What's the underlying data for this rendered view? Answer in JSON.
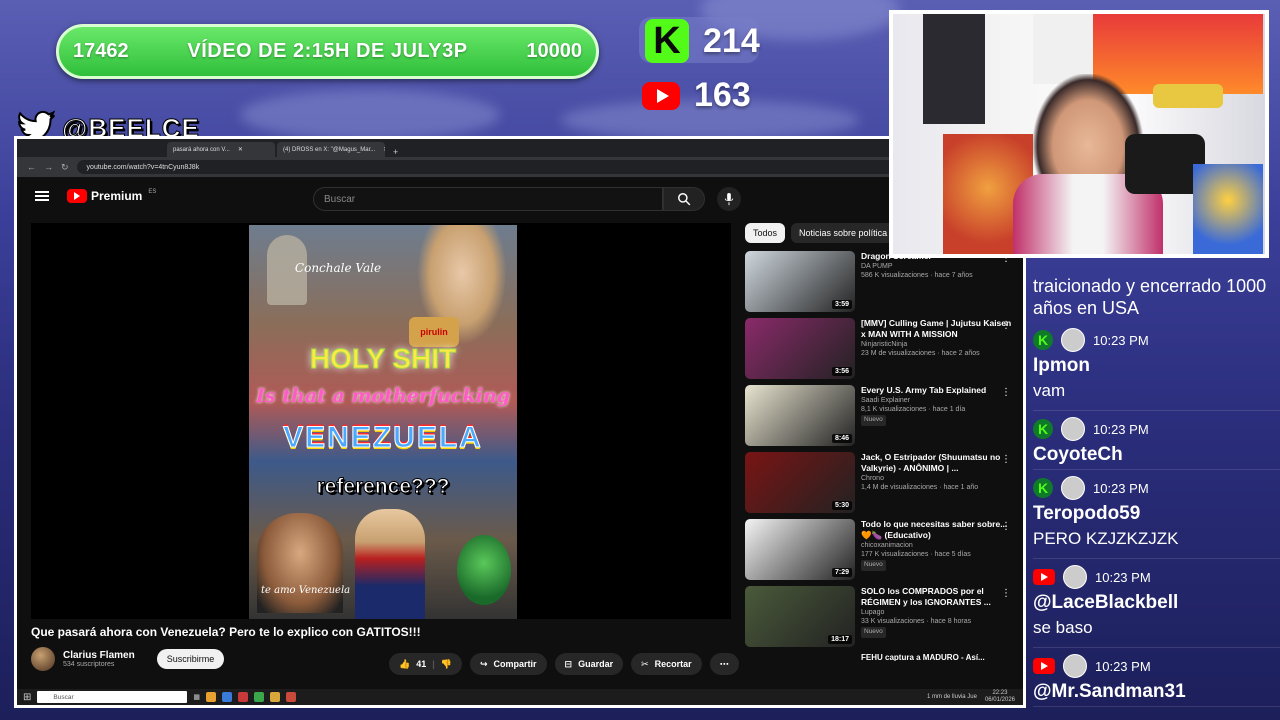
{
  "goal": {
    "left_num": "17462",
    "title": "VÍDEO DE 2:15H DE JULY3P",
    "right_num": "10000"
  },
  "counters": {
    "kick_count": "214",
    "youtube_count": "163"
  },
  "twitter_handle": "@BEELCE_",
  "browser": {
    "tabs": [
      "pasará ahora con V...",
      "(4) DROSS en X: \"@Magus_Mar..."
    ],
    "url": "youtube.com/watch?v=4tnCyun8J8k"
  },
  "youtube": {
    "logo_text": "Premium",
    "logo_region": "ES",
    "search_placeholder": "Buscar",
    "thumbnail_texts": {
      "t1": "Conchale Vale",
      "t2": "HOLY SHIT",
      "t3": "Is that a motherfucking",
      "t4": "VENEZUELA",
      "t5": "reference???",
      "t6": "te amo Venezuela",
      "brand": "pirulin"
    },
    "video_title": "Que pasará ahora con Venezuela? Pero te lo explico con GATITOS!!!",
    "channel_name": "Clarius Flamen",
    "subscribers": "534 suscriptores",
    "subscribe_label": "Suscribirme",
    "likes": "41",
    "share_label": "Compartir",
    "save_label": "Guardar",
    "clip_label": "Recortar",
    "chips": [
      "Todos",
      "Noticias sobre política"
    ],
    "recommendations": [
      {
        "title": "Dragon Screamer",
        "channel": "DA PUMP",
        "meta": "586 K visualizaciones · hace 7 años",
        "duration": "3:59",
        "new": "",
        "color": "#cfd8df"
      },
      {
        "title": "[MMV] Culling Game | Jujutsu Kaisen x MAN WITH A MISSION",
        "channel": "NinjaristicNinja",
        "meta": "23 M de visualizaciones · hace 2 años",
        "duration": "3:56",
        "new": "",
        "color": "#8a2a6a"
      },
      {
        "title": "Every U.S. Army Tab Explained",
        "channel": "Saadi Explainer",
        "meta": "8,1 K visualizaciones · hace 1 día",
        "duration": "8:46",
        "new": "Nuevo",
        "color": "#e8e4d0"
      },
      {
        "title": "Jack, O Estripador (Shuumatsu no Valkyrie) - ANÔNIMO | ...",
        "channel": "Chrono",
        "meta": "1,4 M de visualizaciones · hace 1 año",
        "duration": "5:30",
        "new": "",
        "color": "#7a1414"
      },
      {
        "title": "Todo lo que necesitas saber sobre... 🧡🍆 (Educativo)",
        "channel": "chicoxanimacion",
        "meta": "177 K visualizaciones · hace 5 días",
        "duration": "7:29",
        "new": "Nuevo",
        "color": "#f4f4f4"
      },
      {
        "title": "SOLO los COMPRADOS por el RÉGIMEN y los IGNORANTES ...",
        "channel": "Lupago",
        "meta": "33 K visualizaciones · hace 8 horas",
        "duration": "18:17",
        "new": "Nuevo",
        "color": "#4a5a3a"
      }
    ],
    "rec_cut": "FEHU captura a MADURO - Así..."
  },
  "taskbar": {
    "search": "Buscar",
    "weather": "1 mm de lluvia Jue",
    "time": "22:23",
    "date": "06/01/2026"
  },
  "chat": {
    "top_text": "traicionado y encerrado 1000 años en USA",
    "messages": [
      {
        "platform": "kick",
        "time": "10:23 PM",
        "user": "Ipmon",
        "text": "vam"
      },
      {
        "platform": "kick",
        "time": "10:23 PM",
        "user": "CoyoteCh",
        "text": ""
      },
      {
        "platform": "kick",
        "time": "10:23 PM",
        "user": "Teropodo59",
        "text": "PERO KZJZKZJZK"
      },
      {
        "platform": "youtube",
        "time": "10:23 PM",
        "user": "@LaceBlackbell",
        "text": "se baso"
      },
      {
        "platform": "youtube",
        "time": "10:23 PM",
        "user": "@Mr.Sandman31",
        "text": ""
      }
    ]
  }
}
